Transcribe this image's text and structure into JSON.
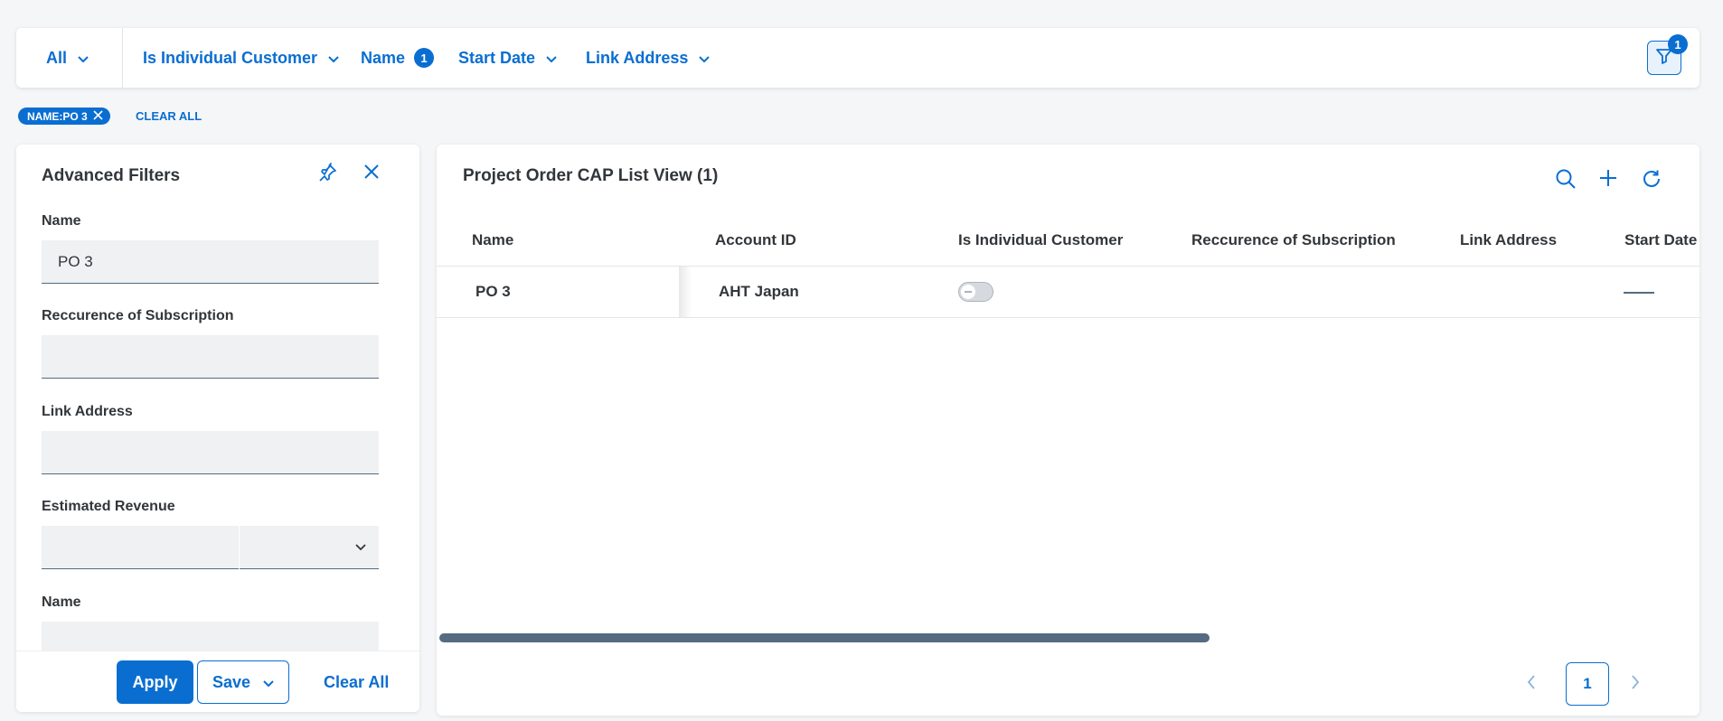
{
  "filter_bar": {
    "items": [
      {
        "label": "All"
      },
      {
        "label": "Is Individual Customer"
      },
      {
        "label": "Name",
        "badge": "1"
      },
      {
        "label": "Start Date"
      },
      {
        "label": "Link Address"
      }
    ],
    "filter_button_badge": "1"
  },
  "active_filters": {
    "chip_label": "NAME:PO 3",
    "clear_all_label": "CLEAR ALL"
  },
  "advanced_filters": {
    "title": "Advanced Filters",
    "fields": [
      {
        "label": "Name",
        "value": "PO 3"
      },
      {
        "label": "Reccurence of Subscription",
        "value": ""
      },
      {
        "label": "Link Address",
        "value": ""
      },
      {
        "label": "Estimated Revenue",
        "value": ""
      },
      {
        "label": "Name",
        "value": ""
      }
    ],
    "apply_label": "Apply",
    "save_label": "Save",
    "clear_all_label": "Clear All"
  },
  "list_view": {
    "title": "Project Order CAP List View (1)",
    "columns": [
      "Name",
      "Account ID",
      "Is Individual Customer",
      "Reccurence of Subscription",
      "Link Address",
      "Start Date"
    ],
    "rows": [
      {
        "name": "PO 3",
        "account_id": "AHT Japan",
        "is_individual_customer": false,
        "reccurence": "",
        "link_address": "",
        "start_date": ""
      }
    ],
    "pagination": {
      "current_page": "1"
    }
  },
  "colors": {
    "accent": "#0a6ed1",
    "background": "#f5f6f7",
    "text": "#32363a"
  }
}
